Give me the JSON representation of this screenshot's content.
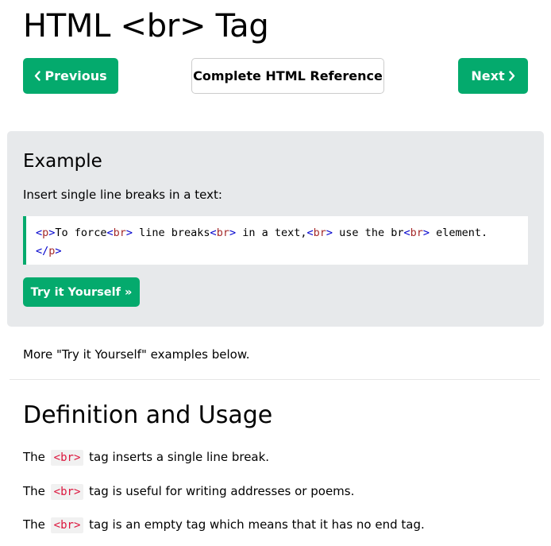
{
  "page": {
    "title": "HTML <br> Tag"
  },
  "nav": {
    "previous_label": "Previous",
    "reference_label": "Complete HTML Reference",
    "next_label": "Next",
    "previous_icon": "chevron-left-icon",
    "next_icon": "chevron-right-icon"
  },
  "colors": {
    "accent": "#04AA6D",
    "example_bg": "#E7E9EB",
    "inline_code_text": "#dc143c",
    "inline_code_bg": "#f1f1f1"
  },
  "example": {
    "heading": "Example",
    "description": "Insert single line breaks in a text:",
    "code_lines": [
      [
        {
          "t": "<",
          "c": "punct"
        },
        {
          "t": "p",
          "c": "tag"
        },
        {
          "t": ">",
          "c": "punct"
        },
        {
          "t": "To force",
          "c": "text"
        },
        {
          "t": "<",
          "c": "punct"
        },
        {
          "t": "br",
          "c": "tag"
        },
        {
          "t": ">",
          "c": "punct"
        },
        {
          "t": " line breaks",
          "c": "text"
        },
        {
          "t": "<",
          "c": "punct"
        },
        {
          "t": "br",
          "c": "tag"
        },
        {
          "t": ">",
          "c": "punct"
        },
        {
          "t": " in a text,",
          "c": "text"
        },
        {
          "t": "<",
          "c": "punct"
        },
        {
          "t": "br",
          "c": "tag"
        },
        {
          "t": ">",
          "c": "punct"
        },
        {
          "t": " use the br",
          "c": "text"
        },
        {
          "t": "<",
          "c": "punct"
        },
        {
          "t": "br",
          "c": "tag"
        },
        {
          "t": ">",
          "c": "punct"
        },
        {
          "t": " element.",
          "c": "text"
        }
      ],
      [
        {
          "t": "</",
          "c": "punct"
        },
        {
          "t": "p",
          "c": "tag"
        },
        {
          "t": ">",
          "c": "punct"
        }
      ]
    ],
    "try_button_label": "Try it Yourself »"
  },
  "more_examples_text": "More \"Try it Yourself\" examples below.",
  "definition": {
    "heading": "Definition and Usage",
    "code_tag": "<br>",
    "paragraphs": [
      {
        "before": "The ",
        "after": " tag inserts a single line break."
      },
      {
        "before": "The ",
        "after": " tag is useful for writing addresses or poems."
      },
      {
        "before": "The ",
        "after": " tag is an empty tag which means that it has no end tag."
      }
    ]
  }
}
